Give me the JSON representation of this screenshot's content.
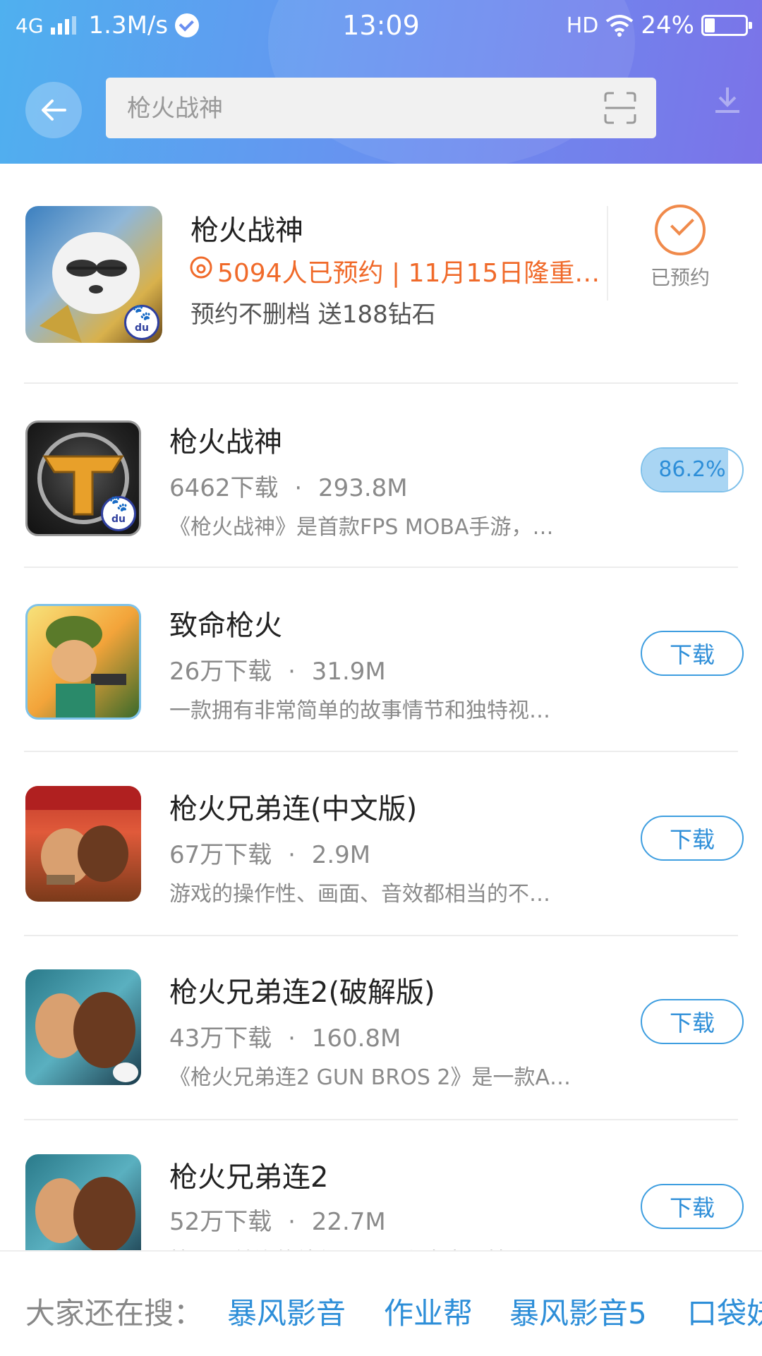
{
  "status_bar": {
    "network": "4G",
    "speed": "1.3M/s",
    "time": "13:09",
    "hd": "HD",
    "battery": "24%"
  },
  "search": {
    "placeholder": "枪火战神",
    "value": ""
  },
  "featured": {
    "title": "枪火战神",
    "promo": "5094人已预约 | 11月15日隆重…",
    "subtitle": "预约不删档 送188钻石",
    "status_label": "已预约"
  },
  "apps": [
    {
      "title": "枪火战神",
      "downloads": "6462下载",
      "size": "293.8M",
      "desc": "《枪火战神》是首款FPS MOBA手游，…",
      "action": "86.2%",
      "progress": 0.862
    },
    {
      "title": "致命枪火",
      "downloads": "26万下载",
      "size": "31.9M",
      "desc": "一款拥有非常简单的故事情节和独特视…",
      "action": "下载"
    },
    {
      "title": "枪火兄弟连(中文版)",
      "downloads": "67万下载",
      "size": "2.9M",
      "desc": "游戏的操作性、画面、音效都相当的不…",
      "action": "下载"
    },
    {
      "title": "枪火兄弟连2(破解版)",
      "downloads": "43万下载",
      "size": "160.8M",
      "desc": "《枪火兄弟连2 GUN BROS 2》是一款A…",
      "action": "下载"
    },
    {
      "title": "枪火兄弟连2",
      "downloads": "52万下载",
      "size": "22.7M",
      "desc": "枪火兄弟连的续作，画面和内容更精彩…",
      "action": "下载"
    }
  ],
  "separator": "·",
  "suggestions": {
    "label": "大家还在搜：",
    "terms": [
      "暴风影音",
      "作业帮",
      "暴风影音5",
      "口袋妖"
    ]
  },
  "colors": {
    "header_start": "#4fb0ef",
    "header_end": "#7b73e8",
    "accent_blue": "#2d8ed8",
    "promo_orange": "#f06a2a"
  }
}
